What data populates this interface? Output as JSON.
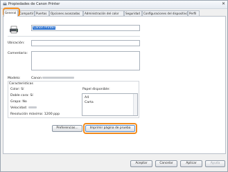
{
  "window": {
    "title": "Propiedades de Canon Printer",
    "close": "✕"
  },
  "tabs": [
    {
      "label": "General"
    },
    {
      "label": "Compartir"
    },
    {
      "label": "Puertos"
    },
    {
      "label": "Opciones avanzadas"
    },
    {
      "label": "Administración del color"
    },
    {
      "label": "Seguridad"
    },
    {
      "label": "Configuraciones del dispositivo"
    },
    {
      "label": "Perfil"
    }
  ],
  "general": {
    "printer_name": "Canon Printer",
    "location_label": "Ubicación:",
    "location_value": "",
    "comment_label": "Comentario:",
    "comment_value": "",
    "model_label": "Modelo:",
    "model_value": "Canon"
  },
  "features": {
    "title": "Características",
    "color": "Color: Sí",
    "duplex": "Doble cara: Sí",
    "staple": "Grapa: No",
    "speed": "Velocidad:",
    "resolution": "Resolución máxima: 1200 ppp",
    "paper_label": "Papel disponible:",
    "paper_items": [
      "A4",
      "Carta"
    ]
  },
  "buttons": {
    "preferences": "Preferencias...",
    "print_test": "Imprimir página de prueba",
    "accept": "Aceptar",
    "cancel": "Cancelar",
    "apply": "Aplicar",
    "help": "Ayuda"
  },
  "colors": {
    "highlight": "#f28a1a",
    "selection": "#2f73cf"
  }
}
